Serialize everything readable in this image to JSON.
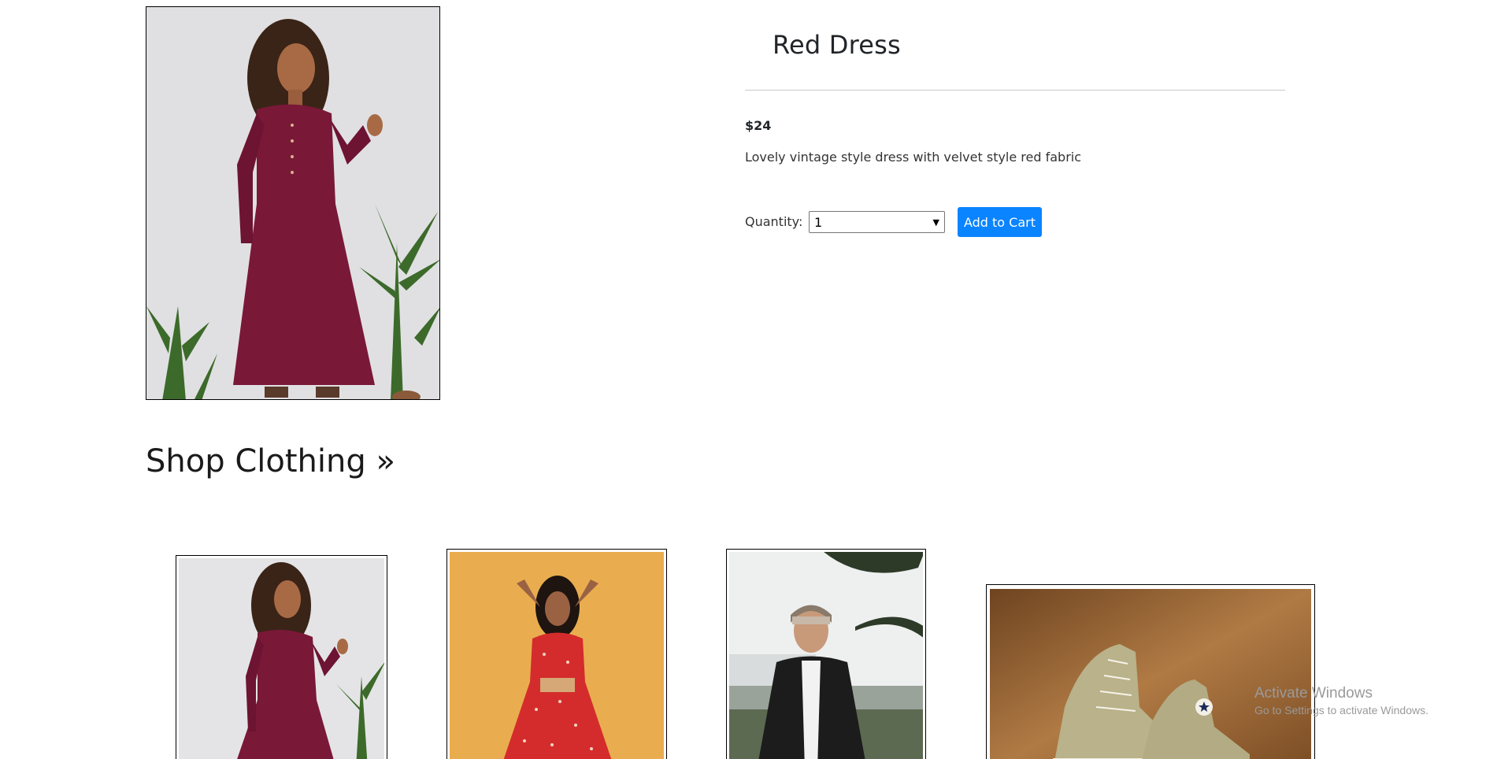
{
  "product": {
    "title": "Red Dress",
    "price": "$24",
    "description": "Lovely vintage style dress with velvet style red fabric",
    "quantity_label": "Quantity:",
    "quantity_value": "1",
    "add_to_cart_label": "Add to Cart"
  },
  "shop": {
    "heading": "Shop Clothing »"
  },
  "thumbnails": [
    {
      "name": "red-dress-thumbnail"
    },
    {
      "name": "floral-dress-thumbnail"
    },
    {
      "name": "leather-jacket-thumbnail"
    },
    {
      "name": "sneakers-thumbnail"
    }
  ],
  "watermark": {
    "title": "Activate Windows",
    "subtitle": "Go to Settings to activate Windows."
  },
  "colors": {
    "accent": "#0a84ff",
    "dress": "#7a1838",
    "floral_bg": "#e9ad4f",
    "sneaker_bg": "#8a5a2b"
  }
}
